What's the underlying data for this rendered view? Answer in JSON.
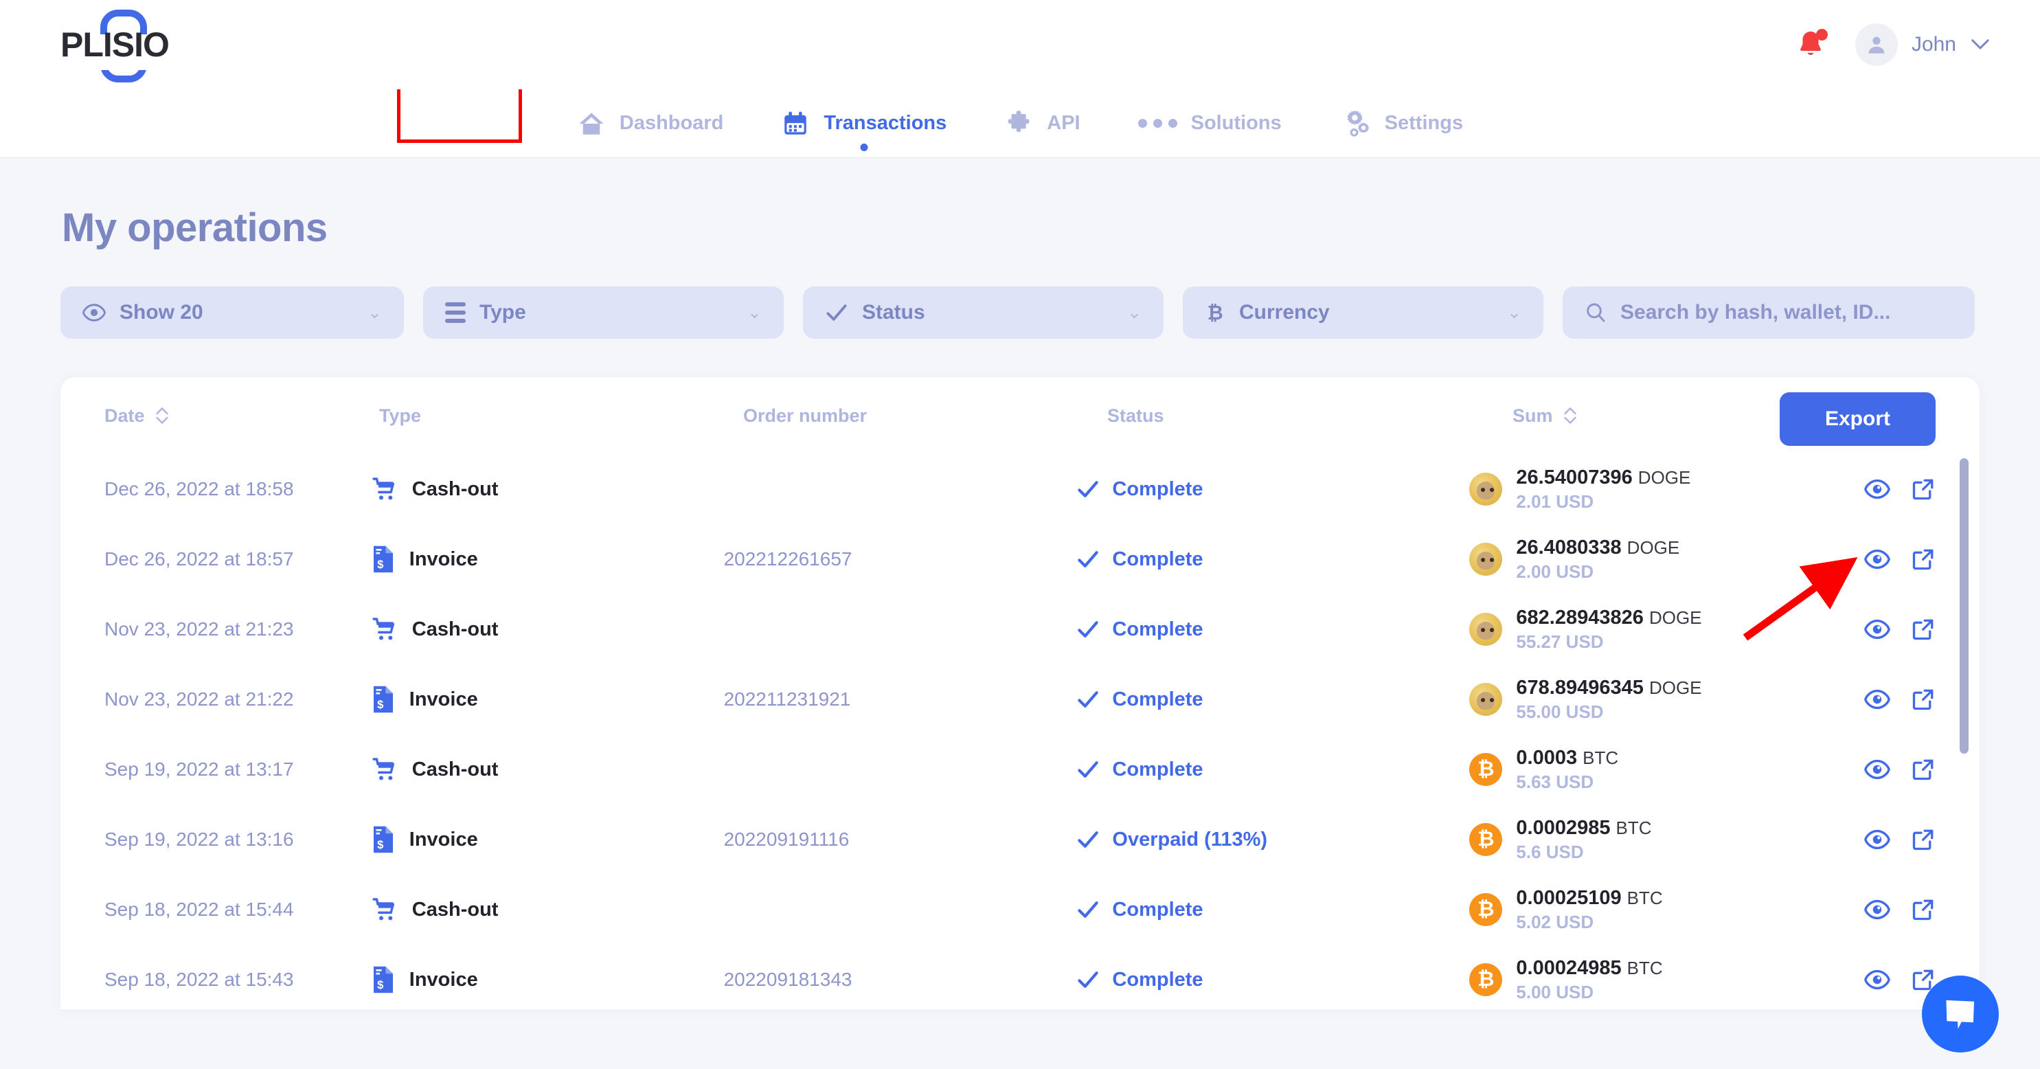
{
  "brand": {
    "name": "PLISIO",
    "accent": "#4169e8"
  },
  "header": {
    "bell_icon": "bell-icon",
    "avatar_icon": "user-avatar-icon",
    "user_name": "John",
    "user_caret": "chevron-down-icon"
  },
  "nav": {
    "items": [
      {
        "label": "Dashboard",
        "icon": "home-icon",
        "active": false
      },
      {
        "label": "Transactions",
        "icon": "calendar-icon",
        "active": true
      },
      {
        "label": "API",
        "icon": "puzzle-icon",
        "active": false
      },
      {
        "label": "Solutions",
        "icon": "dots-icon",
        "active": false
      },
      {
        "label": "Settings",
        "icon": "gears-icon",
        "active": false
      }
    ],
    "highlight_color": "#fb0000"
  },
  "page": {
    "title": "My operations"
  },
  "filters": [
    {
      "label": "Show 20",
      "icon": "eye-icon",
      "chevron": "⌄"
    },
    {
      "label": "Type",
      "icon": "hamburger-icon",
      "chevron": "⌄"
    },
    {
      "label": "Status",
      "icon": "check-icon",
      "chevron": "⌄"
    },
    {
      "label": "Currency",
      "icon": "bitcoin-icon",
      "chevron": "⌄"
    }
  ],
  "search": {
    "placeholder": "Search by hash, wallet, ID...",
    "value": "",
    "icon": "search-icon"
  },
  "table": {
    "columns": [
      {
        "label": "Date",
        "sortable": true
      },
      {
        "label": "Type",
        "sortable": false
      },
      {
        "label": "Order number",
        "sortable": false
      },
      {
        "label": "Status",
        "sortable": false
      },
      {
        "label": "Sum",
        "sortable": true
      }
    ],
    "export_label": "Export",
    "rows": [
      {
        "date": "Dec 26, 2022 at 18:58",
        "type": "Cash-out",
        "type_icon": "cart-icon",
        "order": "",
        "status": "Complete",
        "amount": "26.54007396",
        "ticker": "DOGE",
        "usd": "2.01 USD",
        "coin": "doge"
      },
      {
        "date": "Dec 26, 2022 at 18:57",
        "type": "Invoice",
        "type_icon": "invoice-icon",
        "order": "202212261657",
        "status": "Complete",
        "amount": "26.4080338",
        "ticker": "DOGE",
        "usd": "2.00 USD",
        "coin": "doge"
      },
      {
        "date": "Nov 23, 2022 at 21:23",
        "type": "Cash-out",
        "type_icon": "cart-icon",
        "order": "",
        "status": "Complete",
        "amount": "682.28943826",
        "ticker": "DOGE",
        "usd": "55.27 USD",
        "coin": "doge"
      },
      {
        "date": "Nov 23, 2022 at 21:22",
        "type": "Invoice",
        "type_icon": "invoice-icon",
        "order": "202211231921",
        "status": "Complete",
        "amount": "678.89496345",
        "ticker": "DOGE",
        "usd": "55.00 USD",
        "coin": "doge"
      },
      {
        "date": "Sep 19, 2022 at 13:17",
        "type": "Cash-out",
        "type_icon": "cart-icon",
        "order": "",
        "status": "Complete",
        "amount": "0.0003",
        "ticker": "BTC",
        "usd": "5.63 USD",
        "coin": "btc"
      },
      {
        "date": "Sep 19, 2022 at 13:16",
        "type": "Invoice",
        "type_icon": "invoice-icon",
        "order": "202209191116",
        "status": "Overpaid (113%)",
        "amount": "0.0002985",
        "ticker": "BTC",
        "usd": "5.6 USD",
        "coin": "btc"
      },
      {
        "date": "Sep 18, 2022 at 15:44",
        "type": "Cash-out",
        "type_icon": "cart-icon",
        "order": "",
        "status": "Complete",
        "amount": "0.00025109",
        "ticker": "BTC",
        "usd": "5.02 USD",
        "coin": "btc"
      },
      {
        "date": "Sep 18, 2022 at 15:43",
        "type": "Invoice",
        "type_icon": "invoice-icon",
        "order": "202209181343",
        "status": "Complete",
        "amount": "0.00024985",
        "ticker": "BTC",
        "usd": "5.00 USD",
        "coin": "btc"
      }
    ],
    "row_actions": [
      {
        "icon": "eye-icon"
      },
      {
        "icon": "external-link-icon"
      }
    ]
  },
  "chat": {
    "icon": "chat-bubble-icon",
    "color": "#246bfd"
  }
}
